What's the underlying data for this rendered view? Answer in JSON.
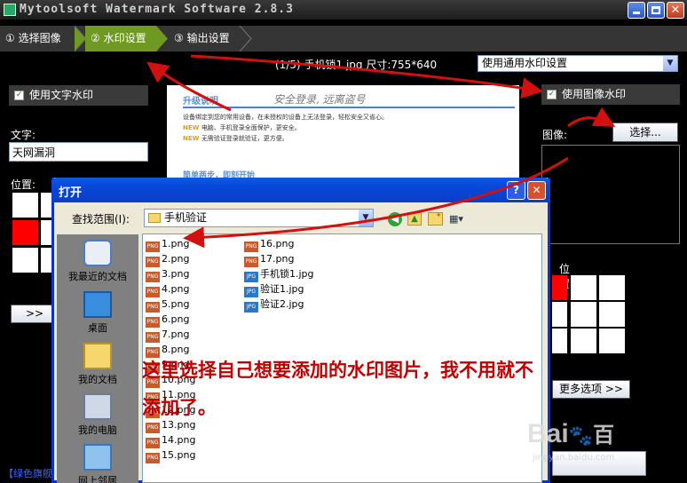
{
  "window": {
    "title": "Mytoolsoft Watermark Software 2.8.3"
  },
  "steps": [
    {
      "label": "① 选择图像"
    },
    {
      "label": "② 水印设置"
    },
    {
      "label": "③ 输出设置"
    }
  ],
  "image_info": "(1/5) 手机锁1.jpg 尺寸:755*640",
  "watermark_mode": {
    "selected": "使用通用水印设置"
  },
  "text_panel": {
    "header": "使用文字水印",
    "text_label": "文字:",
    "text_value": "天网漏洞",
    "position_label": "位置:",
    "hide_button": ">> 隐"
  },
  "image_panel": {
    "header": "使用图像水印",
    "image_label": "图像:",
    "select_button": "选择...",
    "position_label": "位置:",
    "more_button": "更多选项 >>"
  },
  "preview": {
    "heading": "升级说明",
    "slogan": "安全登录, 远离盗号",
    "line1": "设备绑定到您的常用设备，在未授权的设备上无法登录，轻松安全又省心。",
    "line2": "电脑、手机登录全面保护，更安全。",
    "line3": "无需验证登录就验证，更方便。",
    "footer": "简单两步，即刻开始"
  },
  "footer_link": "【绿色旗舰",
  "dialog": {
    "title": "打开",
    "lookin_label": "查找范围(I):",
    "lookin_value": "手机验证",
    "places": [
      "我最近的文档",
      "桌面",
      "我的文档",
      "我的电脑",
      "网上邻居"
    ],
    "files_col1": [
      "1.png",
      "2.png",
      "3.png",
      "4.png",
      "5.png",
      "6.png",
      "7.png",
      "8.png",
      "9.png",
      "10.png",
      "11.png",
      "12.png",
      "13.png",
      "14.png",
      "15.png"
    ],
    "files_col2": [
      {
        "name": "16.png",
        "type": "png"
      },
      {
        "name": "17.png",
        "type": "png"
      },
      {
        "name": "手机锁1.jpg",
        "type": "jpg"
      },
      {
        "name": "验证1.jpg",
        "type": "jpg"
      },
      {
        "name": "验证2.jpg",
        "type": "jpg"
      }
    ]
  },
  "annotation": "这里选择自己想要添加的水印图片，我不用就不添加了。",
  "watermark": {
    "brand": "Bai",
    "brand2": "百",
    "url": "jingyan.baidu.com"
  },
  "colors": {
    "step_active": "#6e9a22",
    "arrow": "#d31010",
    "dialog_title": "#0846d8",
    "selected_cell": "#ff0000"
  }
}
